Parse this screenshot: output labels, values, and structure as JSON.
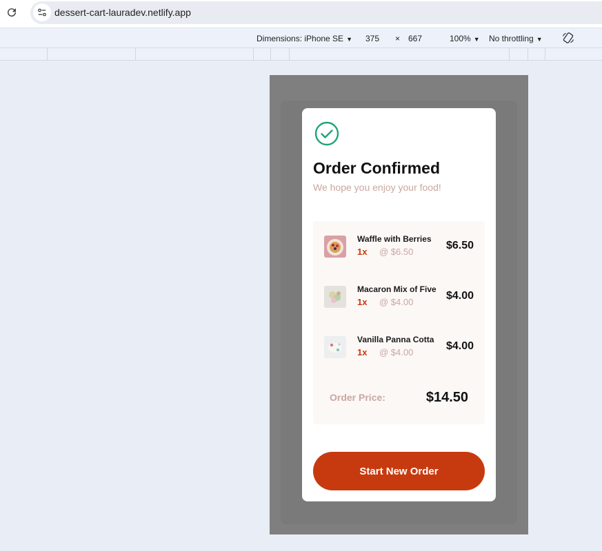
{
  "browser": {
    "url": "dessert-cart-lauradev.netlify.app"
  },
  "devtools": {
    "dimensions_label": "Dimensions: iPhone SE",
    "width": "375",
    "times": "×",
    "height": "667",
    "zoom": "100%",
    "throttling": "No throttling"
  },
  "modal": {
    "title": "Order Confirmed",
    "subtitle": "We hope you enjoy your food!",
    "items": [
      {
        "name": "Waffle with Berries",
        "qty": "1x",
        "unit_price": "@ $6.50",
        "total": "$6.50"
      },
      {
        "name": "Macaron Mix of Five",
        "qty": "1x",
        "unit_price": "@ $4.00",
        "total": "$4.00"
      },
      {
        "name": "Vanilla Panna Cotta",
        "qty": "1x",
        "unit_price": "@ $4.00",
        "total": "$4.00"
      }
    ],
    "order_label": "Order Price:",
    "order_total": "$14.50",
    "button_label": "Start New Order"
  },
  "colors": {
    "accent": "#c73a0f",
    "success": "#1ea475",
    "muted": "#c9a7a0",
    "overlay": "#7f7f7f"
  },
  "icons": [
    "reload-icon",
    "site-settings-icon",
    "check-circle-icon",
    "rotate-icon",
    "caret-down-icon"
  ]
}
